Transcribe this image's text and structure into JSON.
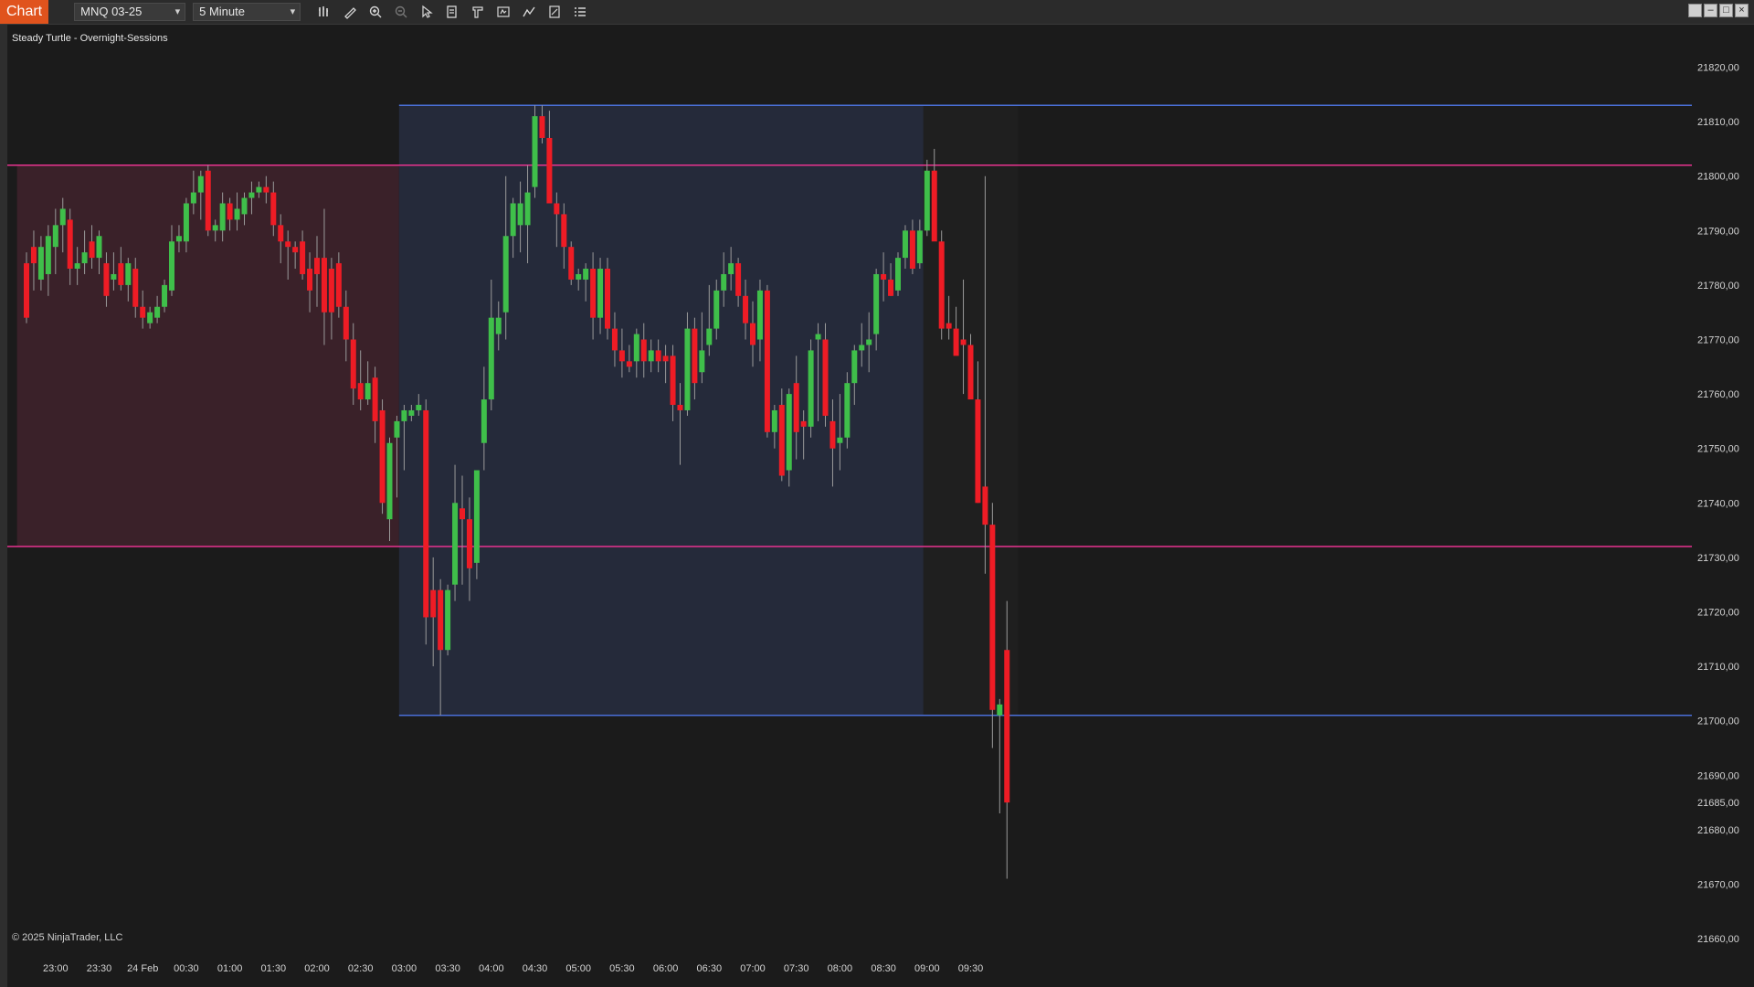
{
  "window": {
    "tab_label": "Chart",
    "instrument": "MNQ 03-25",
    "interval": "5 Minute"
  },
  "toolbar": {
    "tools": [
      "bar-type-icon",
      "drawing-tool-icon",
      "zoom-in-icon",
      "zoom-out-icon",
      "pointer-icon",
      "data-box-icon",
      "properties-icon",
      "screenshot-icon",
      "indicators-icon",
      "strategies-icon",
      "list-icon"
    ]
  },
  "chart": {
    "indicator_label": "Steady Turtle - Overnight-Sessions",
    "copyright": "© 2025 NinjaTrader, LLC",
    "colors": {
      "up": "#3fbf4a",
      "down": "#ee1c25",
      "wick": "#9a9a9a",
      "range_line_magenta": "#e8338f",
      "range_line_blue": "#4a6fd8",
      "session_box_red": "#3a2129",
      "session_box_blue": "#252a3a",
      "after_box": "#1f1f1f"
    }
  },
  "chart_data": {
    "type": "candlestick",
    "title": "",
    "y_range": [
      21657,
      21828
    ],
    "y_ticks": [
      "21820,00",
      "21810,00",
      "21800,00",
      "21790,00",
      "21780,00",
      "21770,00",
      "21760,00",
      "21750,00",
      "21740,00",
      "21730,00",
      "21720,00",
      "21710,00",
      "21700,00",
      "21690,00",
      "21685,00",
      "21680,00",
      "21670,00",
      "21660,00"
    ],
    "x_ticks": [
      "23:00",
      "23:30",
      "24 Feb",
      "00:30",
      "01:00",
      "01:30",
      "02:00",
      "02:30",
      "03:00",
      "03:30",
      "04:00",
      "04:30",
      "05:00",
      "05:30",
      "06:00",
      "06:30",
      "07:00",
      "07:30",
      "08:00",
      "08:30",
      "09:00",
      "09:30"
    ],
    "x_tick_bar_index": [
      4,
      10,
      16,
      22,
      28,
      34,
      40,
      46,
      52,
      58,
      64,
      70,
      76,
      82,
      88,
      94,
      100,
      106,
      112,
      118,
      124,
      130
    ],
    "levels": {
      "overnight_high": 21802,
      "overnight_low": 21732,
      "range_high": 21813,
      "range_low": 21701
    },
    "zones": {
      "red_zone_bars": [
        -1.3,
        51.3
      ],
      "blue_zone_bars": [
        51.3,
        123.5
      ],
      "dark_zone_bars": [
        123.5,
        136.5
      ]
    },
    "candles": [
      [
        21784,
        21786,
        21773,
        21774
      ],
      [
        21787,
        21790,
        21779,
        21784
      ],
      [
        21781,
        21789,
        21779,
        21787
      ],
      [
        21782,
        21791,
        21778,
        21789
      ],
      [
        21787,
        21794,
        21782,
        21791
      ],
      [
        21791,
        21796,
        21786,
        21794
      ],
      [
        21792,
        21794,
        21780,
        21783
      ],
      [
        21783,
        21787,
        21780,
        21784
      ],
      [
        21784,
        21790,
        21782,
        21786
      ],
      [
        21788,
        21791,
        21783,
        21785
      ],
      [
        21785,
        21790,
        21782,
        21789
      ],
      [
        21784,
        21786,
        21776,
        21778
      ],
      [
        21781,
        21786,
        21779,
        21782
      ],
      [
        21784,
        21787,
        21779,
        21780
      ],
      [
        21780,
        21785,
        21777,
        21784
      ],
      [
        21783,
        21785,
        21774,
        21776
      ],
      [
        21776,
        21779,
        21772,
        21774
      ],
      [
        21773,
        21776,
        21772,
        21775
      ],
      [
        21774,
        21778,
        21773,
        21776
      ],
      [
        21776,
        21781,
        21775,
        21780
      ],
      [
        21779,
        21791,
        21778,
        21788
      ],
      [
        21788,
        21791,
        21786,
        21789
      ],
      [
        21788,
        21796,
        21786,
        21795
      ],
      [
        21795,
        21801,
        21793,
        21797
      ],
      [
        21797,
        21801,
        21792,
        21800
      ],
      [
        21801,
        21802,
        21789,
        21790
      ],
      [
        21790,
        21792,
        21788,
        21791
      ],
      [
        21790,
        21797,
        21788,
        21795
      ],
      [
        21795,
        21796,
        21790,
        21792
      ],
      [
        21792,
        21797,
        21790,
        21794
      ],
      [
        21793,
        21797,
        21791,
        21796
      ],
      [
        21796,
        21799,
        21793,
        21797
      ],
      [
        21797,
        21799,
        21796,
        21798
      ],
      [
        21798,
        21800,
        21795,
        21797
      ],
      [
        21797,
        21799,
        21789,
        21791
      ],
      [
        21791,
        21793,
        21784,
        21788
      ],
      [
        21788,
        21790,
        21781,
        21787
      ],
      [
        21787,
        21788,
        21783,
        21786
      ],
      [
        21788,
        21790,
        21781,
        21782
      ],
      [
        21783,
        21786,
        21775,
        21779
      ],
      [
        21785,
        21789,
        21776,
        21782
      ],
      [
        21785,
        21794,
        21769,
        21775
      ],
      [
        21783,
        21785,
        21770,
        21775
      ],
      [
        21784,
        21786,
        21774,
        21776
      ],
      [
        21776,
        21779,
        21766,
        21770
      ],
      [
        21770,
        21773,
        21758,
        21761
      ],
      [
        21762,
        21768,
        21757,
        21759
      ],
      [
        21759,
        21766,
        21758,
        21762
      ],
      [
        21763,
        21765,
        21751,
        21755
      ],
      [
        21757,
        21759,
        21738,
        21740
      ],
      [
        21737,
        21752,
        21733,
        21751
      ],
      [
        21752,
        21756,
        21741,
        21755
      ],
      [
        21755,
        21758,
        21746,
        21757
      ],
      [
        21756,
        21758,
        21755,
        21757
      ],
      [
        21757,
        21760,
        21756,
        21758
      ],
      [
        21757,
        21759,
        21714,
        21719
      ],
      [
        21724,
        21730,
        21710,
        21719
      ],
      [
        21724,
        21726,
        21701,
        21713
      ],
      [
        21713,
        21725,
        21712,
        21724
      ],
      [
        21725,
        21747,
        21722,
        21740
      ],
      [
        21739,
        21745,
        21725,
        21737
      ],
      [
        21737,
        21741,
        21722,
        21728
      ],
      [
        21729,
        21745,
        21726,
        21746
      ],
      [
        21751,
        21765,
        21746,
        21759
      ],
      [
        21759,
        21781,
        21757,
        21774
      ],
      [
        21771,
        21777,
        21768,
        21774
      ],
      [
        21775,
        21800,
        21770,
        21789
      ],
      [
        21789,
        21796,
        21785,
        21795
      ],
      [
        21791,
        21799,
        21786,
        21795
      ],
      [
        21791,
        21802,
        21784,
        21797
      ],
      [
        21798,
        21813,
        21796,
        21811
      ],
      [
        21811,
        21813,
        21806,
        21807
      ],
      [
        21807,
        21812,
        21796,
        21795
      ],
      [
        21795,
        21797,
        21787,
        21793
      ],
      [
        21793,
        21795,
        21783,
        21787
      ],
      [
        21787,
        21788,
        21780,
        21781
      ],
      [
        21781,
        21783,
        21779,
        21782
      ],
      [
        21781,
        21784,
        21777,
        21783
      ],
      [
        21783,
        21786,
        21770,
        21774
      ],
      [
        21774,
        21785,
        21771,
        21783
      ],
      [
        21783,
        21785,
        21770,
        21772
      ],
      [
        21772,
        21775,
        21765,
        21768
      ],
      [
        21768,
        21772,
        21763,
        21766
      ],
      [
        21766,
        21769,
        21764,
        21765
      ],
      [
        21766,
        21772,
        21763,
        21771
      ],
      [
        21770,
        21773,
        21763,
        21766
      ],
      [
        21766,
        21770,
        21764,
        21768
      ],
      [
        21768,
        21770,
        21764,
        21766
      ],
      [
        21767,
        21769,
        21762,
        21766
      ],
      [
        21767,
        21769,
        21755,
        21758
      ],
      [
        21758,
        21762,
        21747,
        21757
      ],
      [
        21757,
        21775,
        21756,
        21772
      ],
      [
        21772,
        21774,
        21759,
        21762
      ],
      [
        21764,
        21775,
        21762,
        21768
      ],
      [
        21769,
        21780,
        21767,
        21772
      ],
      [
        21772,
        21781,
        21770,
        21779
      ],
      [
        21779,
        21786,
        21776,
        21782
      ],
      [
        21782,
        21787,
        21779,
        21784
      ],
      [
        21784,
        21785,
        21776,
        21778
      ],
      [
        21778,
        21781,
        21770,
        21773
      ],
      [
        21773,
        21777,
        21765,
        21769
      ],
      [
        21770,
        21781,
        21766,
        21779
      ],
      [
        21779,
        21780,
        21752,
        21753
      ],
      [
        21753,
        21758,
        21750,
        21757
      ],
      [
        21758,
        21761,
        21744,
        21745
      ],
      [
        21746,
        21761,
        21743,
        21760
      ],
      [
        21762,
        21767,
        21748,
        21753
      ],
      [
        21755,
        21757,
        21748,
        21754
      ],
      [
        21754,
        21770,
        21752,
        21768
      ],
      [
        21770,
        21773,
        21755,
        21771
      ],
      [
        21770,
        21773,
        21754,
        21756
      ],
      [
        21755,
        21759,
        21743,
        21750
      ],
      [
        21751,
        21760,
        21746,
        21752
      ],
      [
        21752,
        21764,
        21750,
        21762
      ],
      [
        21762,
        21769,
        21758,
        21768
      ],
      [
        21768,
        21773,
        21765,
        21769
      ],
      [
        21769,
        21775,
        21764,
        21770
      ],
      [
        21771,
        21783,
        21768,
        21782
      ],
      [
        21782,
        21786,
        21777,
        21781
      ],
      [
        21781,
        21784,
        21778,
        21778
      ],
      [
        21779,
        21786,
        21778,
        21785
      ],
      [
        21785,
        21791,
        21783,
        21790
      ],
      [
        21790,
        21792,
        21782,
        21783
      ],
      [
        21784,
        21792,
        21783,
        21790
      ],
      [
        21790,
        21803,
        21789,
        21801
      ],
      [
        21801,
        21805,
        21792,
        21788
      ],
      [
        21788,
        21790,
        21770,
        21772
      ],
      [
        21773,
        21778,
        21770,
        21772
      ],
      [
        21772,
        21776,
        21768,
        21767
      ],
      [
        21770,
        21781,
        21760,
        21769
      ],
      [
        21769,
        21771,
        21760,
        21759
      ],
      [
        21759,
        21766,
        21740,
        21740
      ],
      [
        21743,
        21800,
        21727,
        21736
      ],
      [
        21736,
        21740,
        21695,
        21702
      ],
      [
        21701,
        21704,
        21683,
        21703
      ],
      [
        21713,
        21722,
        21671,
        21685
      ]
    ]
  }
}
